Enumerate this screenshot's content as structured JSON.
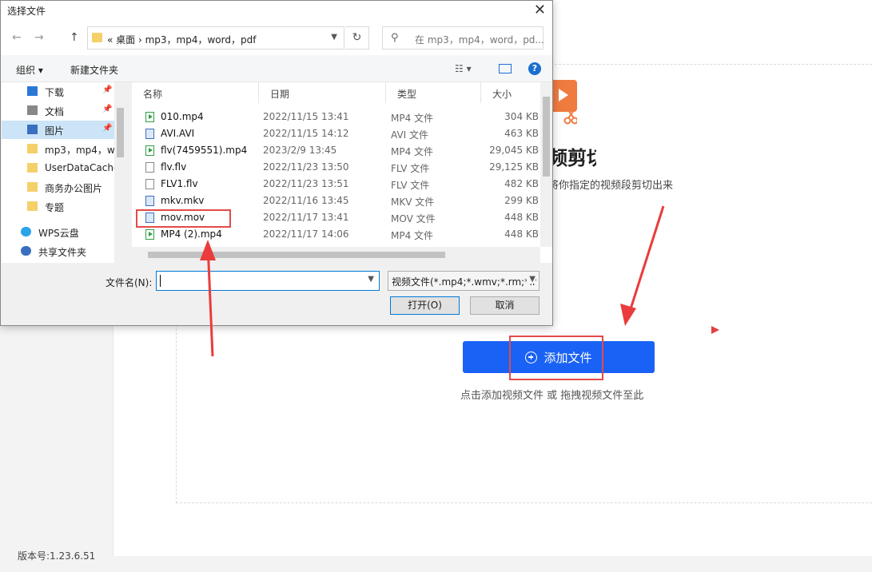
{
  "app": {
    "title": "频剪切",
    "description": "将你指定的视频段剪切出来",
    "add_button": "添加文件",
    "hint": "点击添加视频文件 或 拖拽视频文件至此",
    "version": "版本号:1.23.6.51",
    "accent": "#1a62f5",
    "icon_color": "#f07b3f"
  },
  "dialog": {
    "title": "选择文件",
    "close": "✕",
    "back": "←",
    "forward": "→",
    "up": "↑",
    "path": "«  桌面  ›  mp3，mp4，word，pdf",
    "refresh": "↻",
    "search_placeholder": "在 mp3，mp4，word，pd...",
    "organize": "组织 ▾",
    "new_folder": "新建文件夹",
    "view": "☷ ▾",
    "help": "?",
    "nav": [
      {
        "label": "下载",
        "pinned": true
      },
      {
        "label": "文档",
        "pinned": true
      },
      {
        "label": "图片",
        "pinned": true,
        "selected": true
      },
      {
        "label": "mp3，mp4，w"
      },
      {
        "label": "UserDataCache"
      },
      {
        "label": "商务办公图片"
      },
      {
        "label": "专题"
      },
      {
        "label": "WPS云盘"
      },
      {
        "label": "共享文件夹"
      }
    ],
    "columns": {
      "name": "名称",
      "date": "日期",
      "type": "类型",
      "size": "大小"
    },
    "files": [
      {
        "name": "010.mp4",
        "date": "2022/11/15 13:41",
        "type": "MP4 文件",
        "size": "304 KB",
        "kind": "mp4"
      },
      {
        "name": "AVI.AVI",
        "date": "2022/11/15 14:12",
        "type": "AVI 文件",
        "size": "463 KB",
        "kind": "img"
      },
      {
        "name": "flv(7459551).mp4",
        "date": "2023/2/9 13:45",
        "type": "MP4 文件",
        "size": "29,045 KB",
        "kind": "mp4"
      },
      {
        "name": "flv.flv",
        "date": "2022/11/23 13:50",
        "type": "FLV 文件",
        "size": "29,125 KB",
        "kind": "doc"
      },
      {
        "name": "FLV1.flv",
        "date": "2022/11/23 13:51",
        "type": "FLV 文件",
        "size": "482 KB",
        "kind": "doc"
      },
      {
        "name": "mkv.mkv",
        "date": "2022/11/16 13:45",
        "type": "MKV 文件",
        "size": "299 KB",
        "kind": "img"
      },
      {
        "name": "mov.mov",
        "date": "2022/11/17 13:41",
        "type": "MOV 文件",
        "size": "448 KB",
        "kind": "img"
      },
      {
        "name": "MP4 (2).mp4",
        "date": "2022/11/17 14:06",
        "type": "MP4 文件",
        "size": "448 KB",
        "kind": "mp4"
      }
    ],
    "filename_label": "文件名(N):",
    "filename_value": "",
    "filter": "视频文件(*.mp4;*.wmv;*.rm;*.r",
    "open": "打开(O)",
    "cancel": "取消"
  }
}
